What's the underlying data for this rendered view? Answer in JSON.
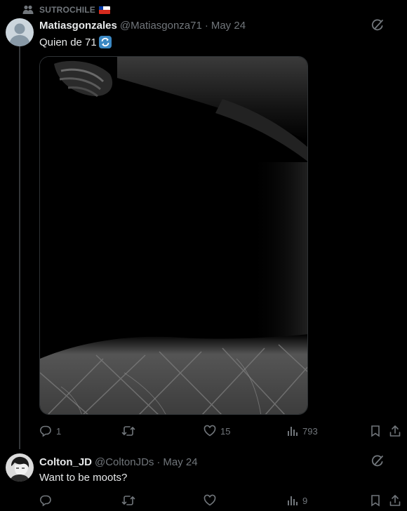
{
  "community": {
    "name": "SUTROCHILE",
    "icon": "community-icon",
    "flag": "chile-flag-icon"
  },
  "posts": [
    {
      "display_name": "Matiasgonzales",
      "handle": "@Matiasgonza71",
      "separator": "·",
      "date": "May 24",
      "text": "Quien de 71",
      "text_emoji": "repeat-emoji-icon",
      "has_media": true,
      "media_icon": "dark-photo",
      "actions": {
        "replies": "1",
        "reposts": "",
        "likes": "15",
        "views": "793"
      }
    },
    {
      "display_name": "Colton_JD",
      "handle": "@ColtonJDs",
      "separator": "·",
      "date": "May 24",
      "text": "Want to be moots?",
      "has_media": false,
      "actions": {
        "replies": "",
        "reposts": "",
        "likes": "",
        "views": "9"
      }
    }
  ],
  "colors": {
    "background": "#000000",
    "text": "#e7e9ea",
    "muted": "#71767b",
    "border": "#2f3336",
    "accent": "#1d9bf0"
  }
}
